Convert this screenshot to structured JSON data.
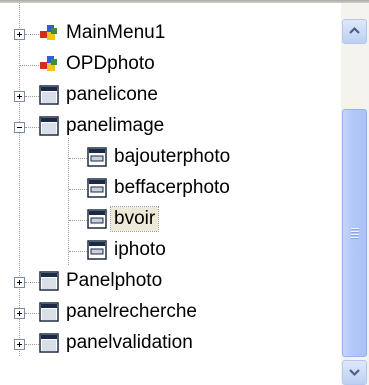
{
  "tree": {
    "items": [
      {
        "label": "MainMenu1",
        "icon": "main-menu-icon",
        "expandable": true,
        "level": 0,
        "selected": false
      },
      {
        "label": "OPDphoto",
        "icon": "dialog-component-icon",
        "expandable": false,
        "level": 0,
        "selected": false
      },
      {
        "label": "panelicone",
        "icon": "panel-icon",
        "expandable": true,
        "level": 0,
        "selected": false
      },
      {
        "label": "panelimage",
        "icon": "panel-icon",
        "expandable": true,
        "expanded": true,
        "level": 0,
        "selected": false
      },
      {
        "label": "bajouterphoto",
        "icon": "button-icon",
        "expandable": false,
        "level": 1,
        "selected": false
      },
      {
        "label": "beffacerphoto",
        "icon": "button-icon",
        "expandable": false,
        "level": 1,
        "selected": false
      },
      {
        "label": "bvoir",
        "icon": "button-icon",
        "expandable": false,
        "level": 1,
        "selected": true
      },
      {
        "label": "iphoto",
        "icon": "button-icon",
        "expandable": false,
        "level": 1,
        "selected": false
      },
      {
        "label": "Panelphoto",
        "icon": "panel-icon",
        "expandable": true,
        "level": 0,
        "selected": false
      },
      {
        "label": "panelrecherche",
        "icon": "panel-icon",
        "expandable": true,
        "level": 0,
        "selected": false
      },
      {
        "label": "panelvalidation",
        "icon": "panel-icon",
        "expandable": true,
        "level": 0,
        "selected": false
      }
    ]
  },
  "scrollbar": {
    "up_icon": "chevron-up-icon",
    "down_icon": "chevron-down-icon"
  },
  "colors": {
    "selection_bg": "#ece9d8",
    "scroll_thumb": "#b4c9f8",
    "chevron": "#4d6185"
  }
}
